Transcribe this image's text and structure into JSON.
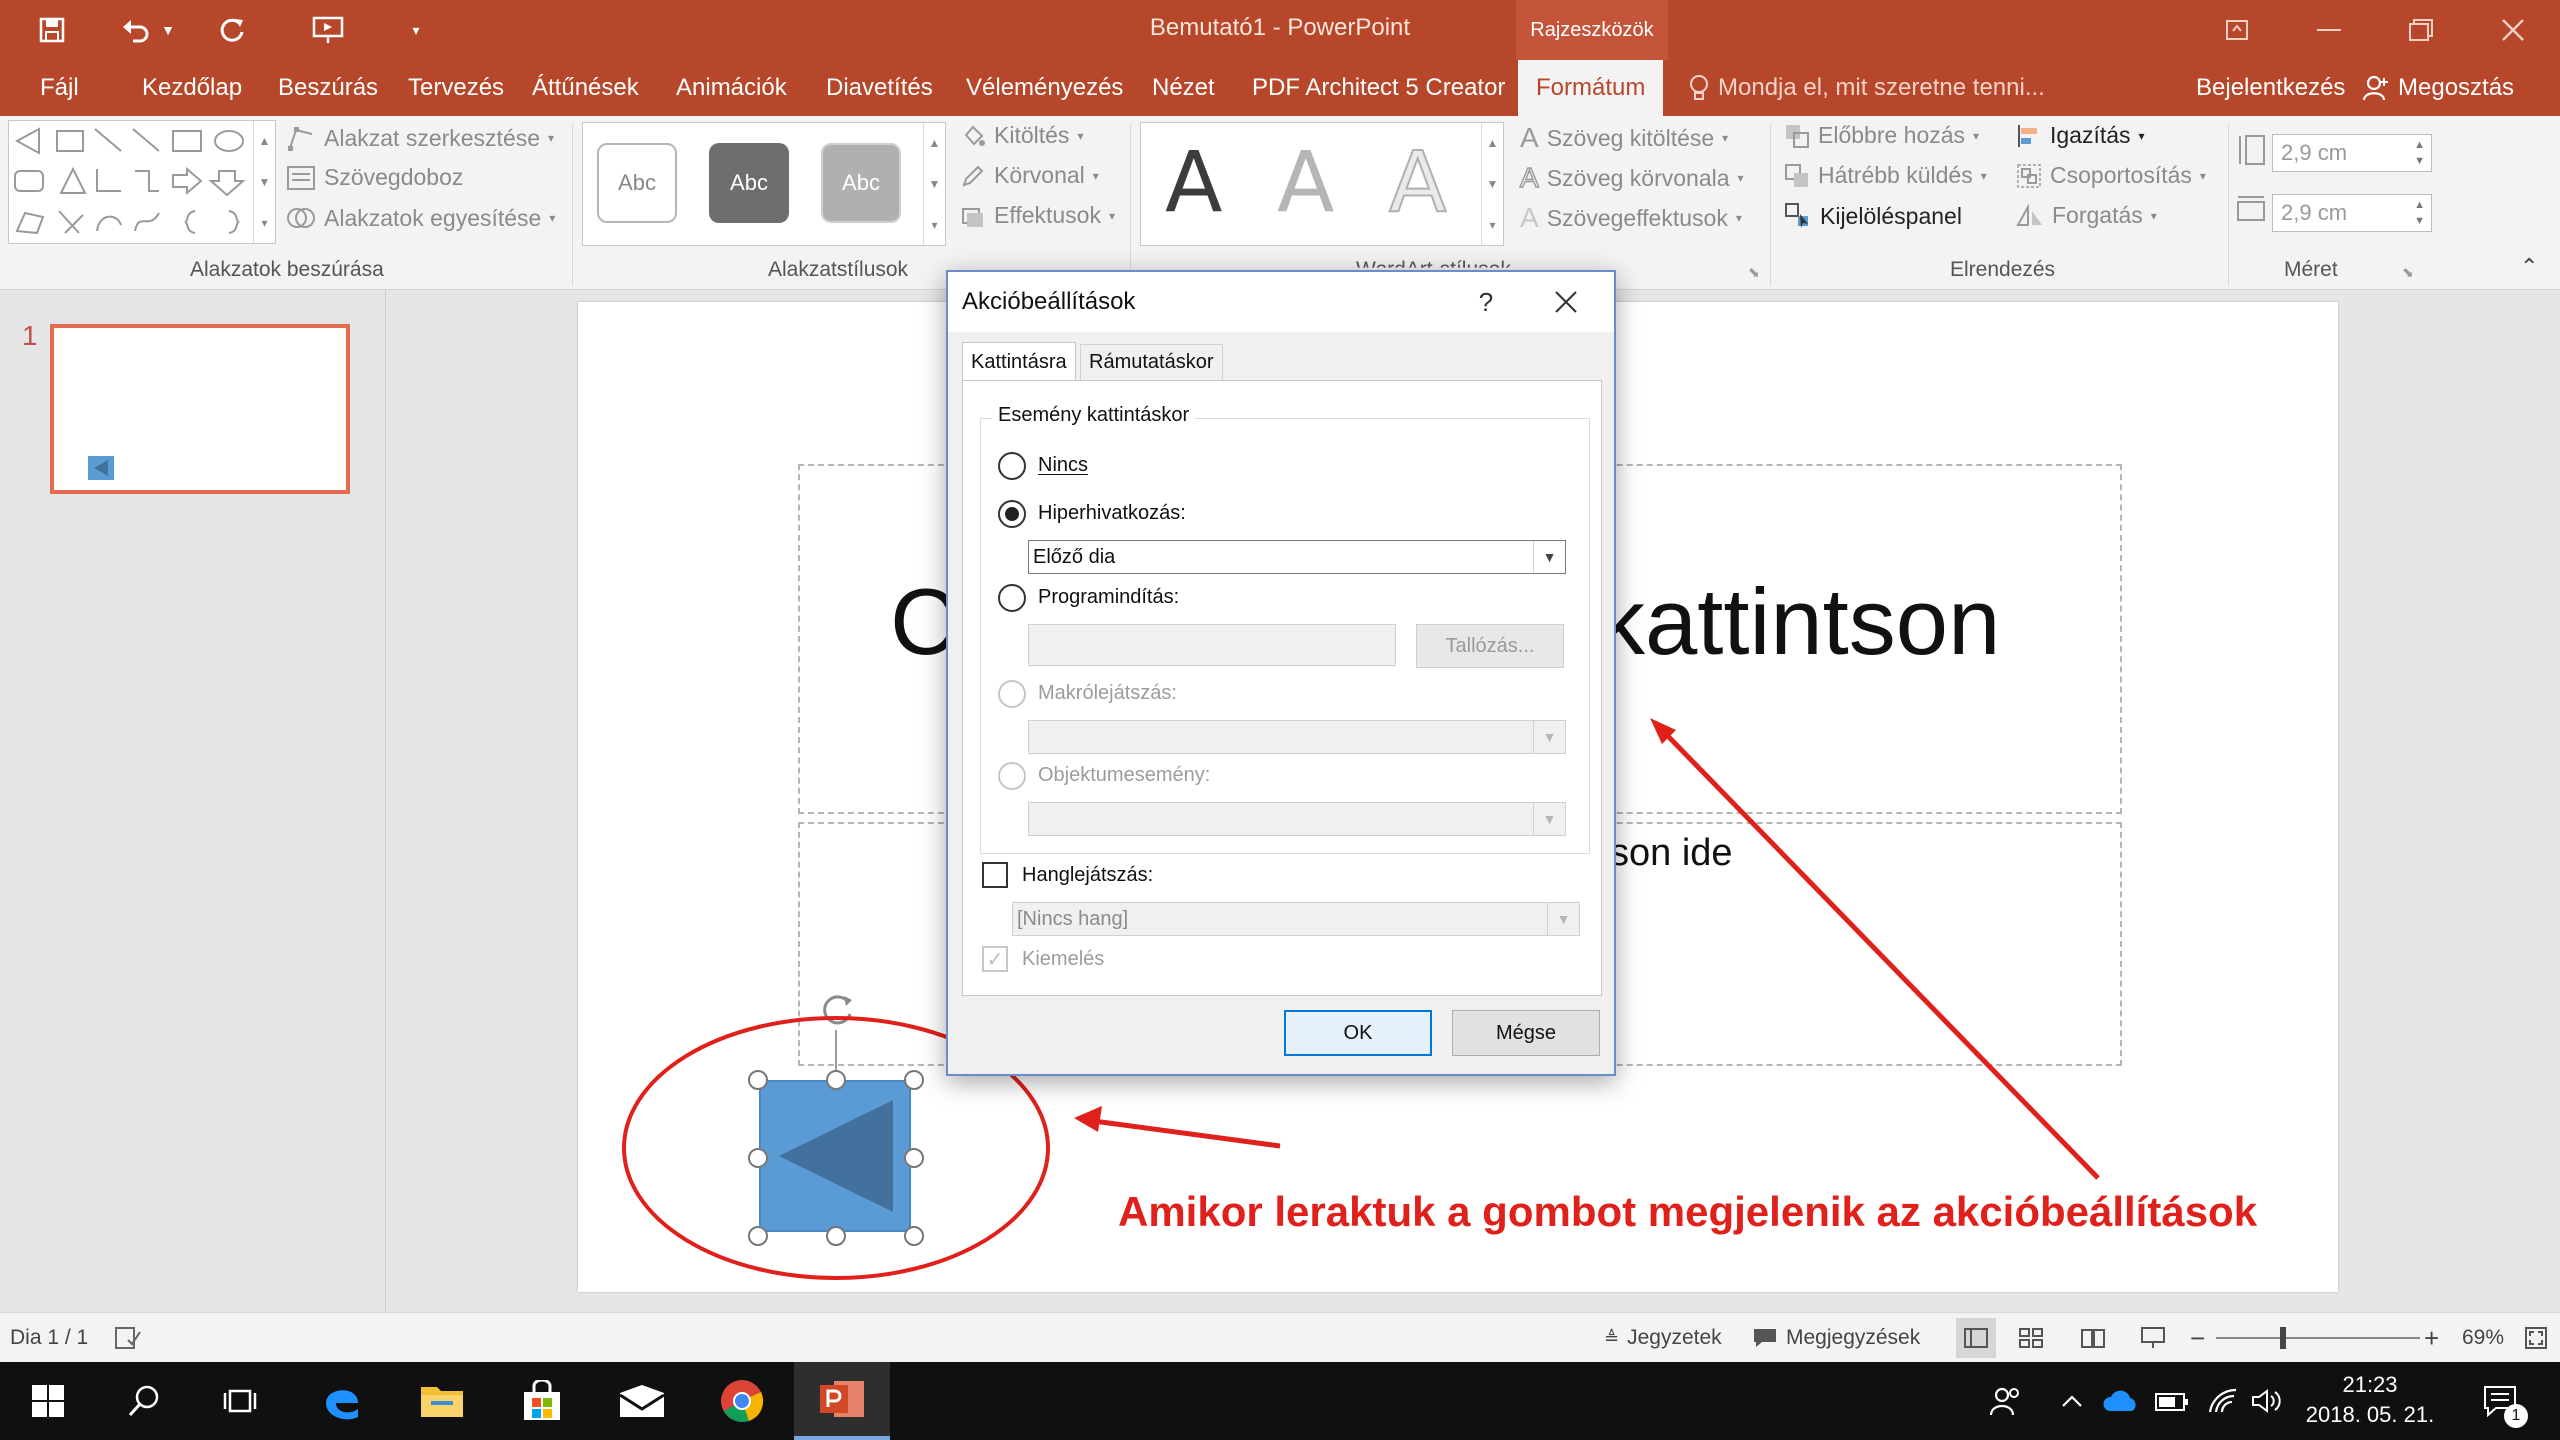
{
  "app": {
    "title": "Bemutató1 - PowerPoint",
    "context_tab_header": "Rajzeszközök"
  },
  "tabs": {
    "file": "Fájl",
    "home": "Kezdőlap",
    "insert": "Beszúrás",
    "design": "Tervezés",
    "transitions": "Áttűnések",
    "animations": "Animációk",
    "slideshow": "Diavetítés",
    "review": "Véleményezés",
    "view": "Nézet",
    "pdf": "PDF Architect 5 Creator",
    "format": "Formátum",
    "tellme": "Mondja el, mit szeretne tenni...",
    "signin": "Bejelentkezés",
    "share": "Megosztás"
  },
  "ribbon": {
    "edit_shape": "Alakzat szerkesztése",
    "textbox": "Szövegdoboz",
    "merge_shapes": "Alakzatok egyesítése",
    "group_insert_shapes": "Alakzatok beszúrása",
    "style_abc": "Abc",
    "fill": "Kitöltés",
    "outline": "Körvonal",
    "effects": "Effektusok",
    "group_shape_styles": "Alakzatstílusok",
    "wordart_letter": "A",
    "group_wordart": "WordArt-stílusok",
    "text_fill": "Szöveg kitöltése",
    "text_outline": "Szöveg körvonala",
    "text_effects": "Szövegeffektusok",
    "bring_forward": "Előbbre hozás",
    "send_backward": "Hátrébb küldés",
    "selection_pane": "Kijelöléspanel",
    "align": "Igazítás",
    "group": "Csoportosítás",
    "rotate": "Forgatás",
    "group_arrange": "Elrendezés",
    "height": "2,9 cm",
    "width": "2,9 cm",
    "group_size": "Méret"
  },
  "thumbnails": {
    "slide_number": "1"
  },
  "slide": {
    "title_left": "C",
    "title_right": "kattintson",
    "subtitle_right": "son ide"
  },
  "annotation": {
    "text": "Amikor leraktuk a gombot megjelenik az akcióbeállítások"
  },
  "dialog": {
    "title": "Akcióbeállítások",
    "help": "?",
    "close": "✕",
    "tab_click": "Kattintásra",
    "tab_hover": "Rámutatáskor",
    "group_label": "Esemény kattintáskor",
    "opt_none": "Nincs",
    "opt_hyperlink": "Hiperhivatkozás:",
    "hyperlink_value": "Előző dia",
    "opt_program": "Programindítás:",
    "browse": "Tallózás...",
    "opt_macro": "Makrólejátszás:",
    "opt_object": "Objektumesemény:",
    "sound_label": "Hanglejátszás:",
    "sound_value": "[Nincs hang]",
    "highlight_label": "Kiemelés",
    "ok": "OK",
    "cancel": "Mégse"
  },
  "statusbar": {
    "slide_info": "Dia 1 / 1",
    "notes": "Jegyzetek",
    "comments": "Megjegyzések",
    "zoom": "69%"
  },
  "taskbar": {
    "time": "21:23",
    "date": "2018. 05. 21.",
    "notification_count": "1"
  },
  "colors": {
    "accent": "#b7472a",
    "annotation": "#e0201b",
    "shape_fill": "#5b9bd5",
    "shape_dark": "#41719c"
  }
}
